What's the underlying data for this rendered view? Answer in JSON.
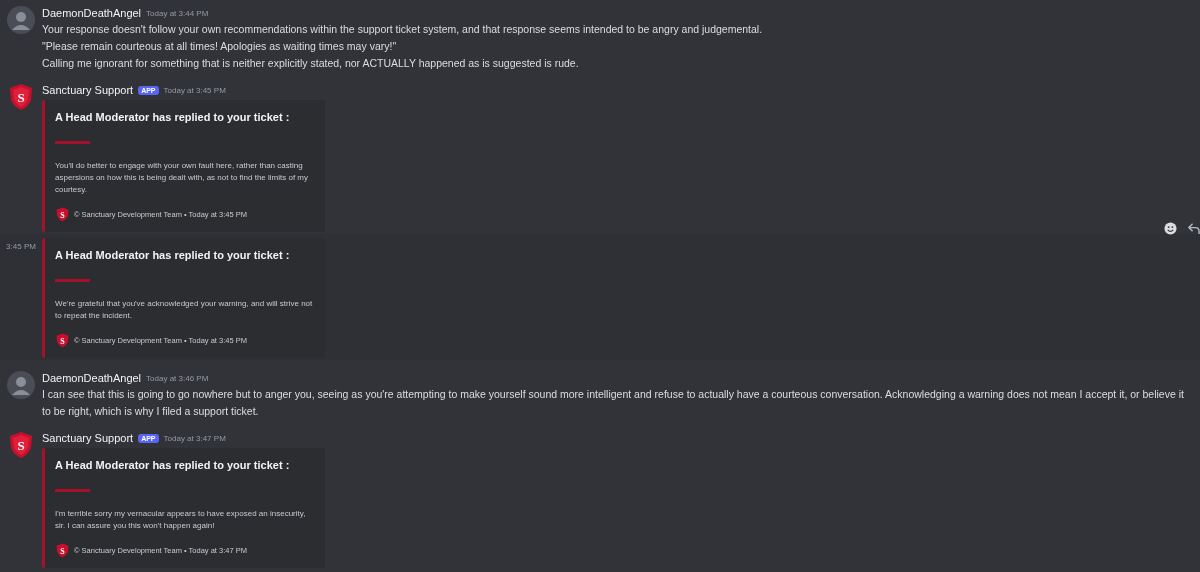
{
  "messages": [
    {
      "kind": "message",
      "hovered": false,
      "author": "DaemonDeathAngel",
      "bot": false,
      "timestamp": "Today at 3:44 PM",
      "lines": [
        "Your response doesn't follow your own recommendations within the support ticket system, and that response seems intended to be angry and judgemental.",
        "\"Please remain courteous at all times! Apologies as waiting times may vary!\"",
        "Calling me ignorant for something that is neither explicitly stated, nor ACTUALLY happened as is suggested is rude."
      ]
    },
    {
      "kind": "message",
      "hovered": false,
      "author": "Sanctuary Support",
      "bot": true,
      "avatar_letter": "S",
      "badge": "APP",
      "timestamp": "Today at 3:45 PM",
      "embed": {
        "title": "A Head Moderator has replied to your ticket :",
        "description": "You'll do better to engage with your own fault here, rather than casting aspersions on how this is being dealt with, as not to find the limits of my courtesy.",
        "footer_letter": "S",
        "footer": "© Sanctuary Development Team • Today at 3:45 PM"
      }
    },
    {
      "kind": "continuation",
      "hovered": true,
      "timestamp": "3:45 PM",
      "embed": {
        "title": "A Head Moderator has replied to your ticket :",
        "description": "We're grateful that you've acknowledged your warning, and will strive not to repeat the incident.",
        "footer_letter": "S",
        "footer": "© Sanctuary Development Team • Today at 3:45 PM"
      }
    },
    {
      "kind": "message",
      "hovered": false,
      "author": "DaemonDeathAngel",
      "bot": false,
      "timestamp": "Today at 3:46 PM",
      "lines": [
        "I can see that this is going to go nowhere but to anger you, seeing as you're attempting to make yourself sound more intelligent and refuse to actually have a courteous conversation. Acknowledging a warning does not mean I accept it, or believe it to be right, which is why I filed a support ticket."
      ]
    },
    {
      "kind": "message",
      "hovered": false,
      "author": "Sanctuary Support",
      "bot": true,
      "avatar_letter": "S",
      "badge": "APP",
      "timestamp": "Today at 3:47 PM",
      "embed": {
        "title": "A Head Moderator has replied to your ticket :",
        "description": "I'm terrible sorry my vernacular appears to have exposed an insecurity, sir. I can assure you this won't happen again!",
        "footer_letter": "S",
        "footer": "© Sanctuary Development Team • Today at 3:47 PM"
      }
    }
  ]
}
